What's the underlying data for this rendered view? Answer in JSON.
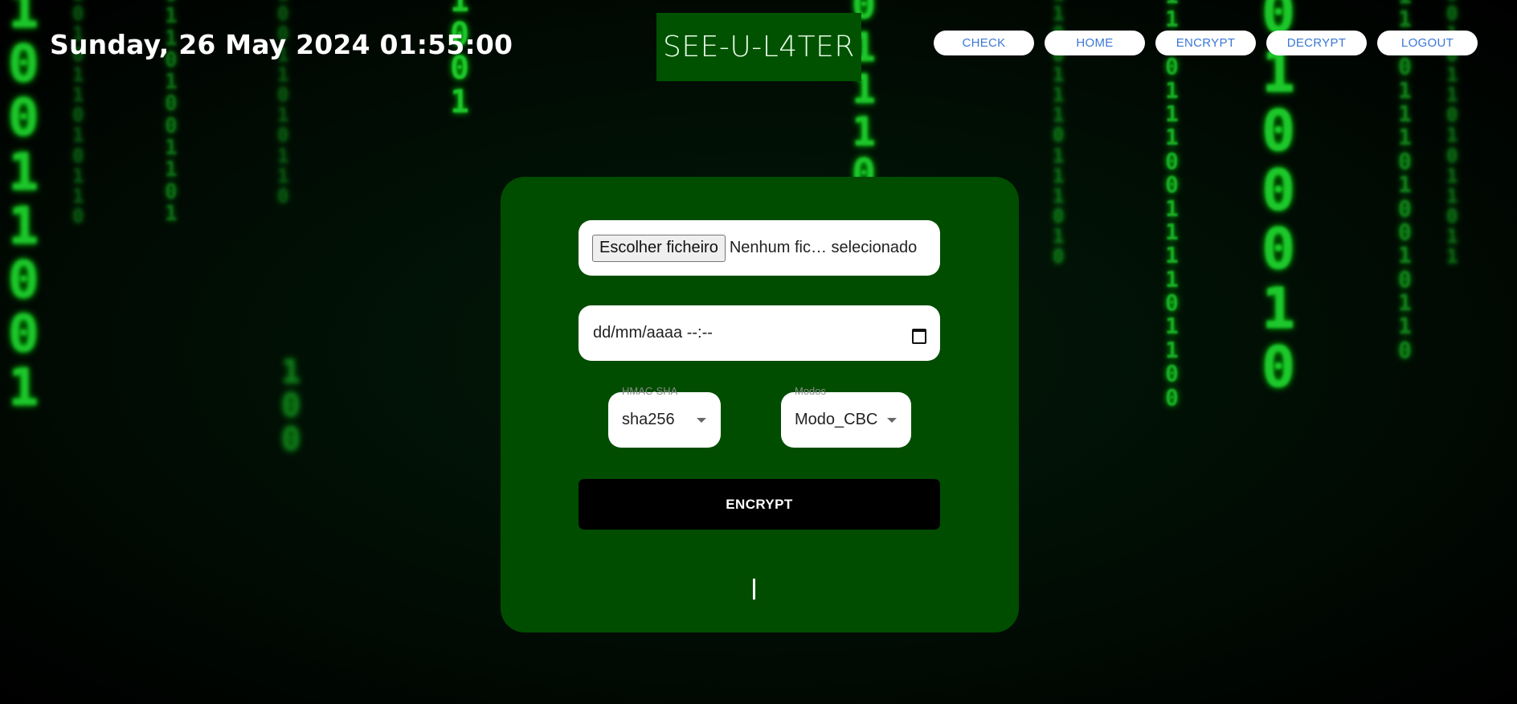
{
  "header": {
    "datetime": "Sunday, 26 May 2024 01:55:00",
    "logo": "SEE-U-L4TER"
  },
  "nav": {
    "items": [
      "CHECK",
      "HOME",
      "ENCRYPT",
      "DECRYPT",
      "LOGOUT"
    ]
  },
  "form": {
    "file_button": "Escolher ficheiro",
    "file_status": "Nenhum fic… selecionado",
    "date_placeholder": "dd/mm/aaaa --:--",
    "hmac": {
      "label": "HMAC-SHA",
      "value": "sha256"
    },
    "mode": {
      "label": "Modos",
      "value": "Modo_CBC"
    },
    "submit_label": "ENCRYPT"
  },
  "colors": {
    "panel": "#004d00",
    "logo_bg": "#005200",
    "nav_text": "#3b78d6",
    "rain": "#22e833"
  },
  "icons": [
    "calendar-icon",
    "dropdown-caret-icon"
  ]
}
